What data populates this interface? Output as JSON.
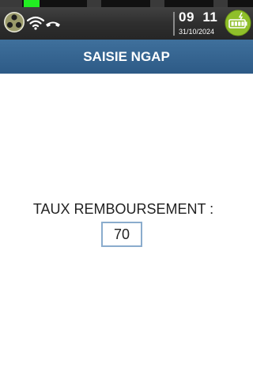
{
  "status_bar": {
    "time_hours": "09",
    "time_minutes": "11",
    "date": "31/10/2024",
    "icons": [
      "sim-network-icon",
      "wifi-icon",
      "phone-hangup-icon",
      "battery-charging-icon"
    ],
    "colors": {
      "signal_active": "#22ee22",
      "battery": "#8fbf2a"
    }
  },
  "header": {
    "title": "SAISIE NGAP",
    "background": "#2f5f8c"
  },
  "main": {
    "label": "TAUX REMBOURSEMENT :",
    "value": "70",
    "field_border_color": "#8aaccd"
  }
}
